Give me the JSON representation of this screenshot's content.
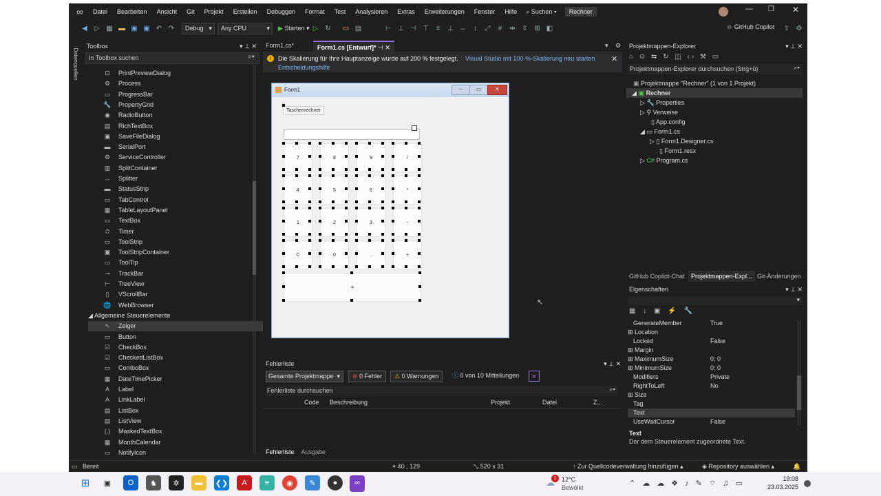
{
  "menu": [
    "Datei",
    "Bearbeiten",
    "Ansicht",
    "Git",
    "Projekt",
    "Erstellen",
    "Debuggen",
    "Format",
    "Test",
    "Analysieren",
    "Extras",
    "Erweiterungen",
    "Fenster",
    "Hilfe"
  ],
  "search_label": "Suchen",
  "solution_badge": "Rechner",
  "toolbar": {
    "config": "Debug",
    "platform": "Any CPU",
    "start": "Starten",
    "copilot": "GitHub Copilot"
  },
  "toolbox": {
    "title": "Toolbox",
    "search_placeholder": "In Toolbox suchen",
    "items": [
      "PrintPreviewDialog",
      "Process",
      "ProgressBar",
      "PropertyGrid",
      "RadioButton",
      "RichTextBox",
      "SaveFileDialog",
      "SerialPort",
      "ServiceController",
      "SplitContainer",
      "Splitter",
      "StatusStrip",
      "TabControl",
      "TableLayoutPanel",
      "TextBox",
      "Timer",
      "ToolStrip",
      "ToolStripContainer",
      "ToolTip",
      "TrackBar",
      "TreeView",
      "VScrollBar",
      "WebBrowser"
    ],
    "group": "Allgemeine Steuerelemente",
    "group_items": [
      "Zeiger",
      "Button",
      "CheckBox",
      "CheckedListBox",
      "ComboBox",
      "DateTimePicker",
      "Label",
      "LinkLabel",
      "ListBox",
      "ListView",
      "MaskedTextBox",
      "MonthCalendar",
      "NotifyIcon"
    ]
  },
  "left_rail": "Datenquellen",
  "tabs": [
    {
      "label": "Form1.cs*"
    },
    {
      "label": "Form1.cs [Entwurf]*"
    }
  ],
  "info_bar": {
    "message": "Die Skalierung für Ihre Hauptanzeige wurde auf 200 % festgelegt.",
    "link1": "Visual Studio mit 100-%-Skalierung neu starten",
    "link2": "Entscheidungshilfe"
  },
  "form": {
    "title": "Form1",
    "label": "Taschenrechner",
    "buttons": [
      "7",
      "8",
      "9",
      "/",
      "4",
      "5",
      "6",
      "*",
      "1",
      "2",
      "3",
      "-",
      "C",
      "0",
      ".",
      "+"
    ],
    "equals": "="
  },
  "error_list": {
    "title": "Fehlerliste",
    "scope": "Gesamte Projektmappe",
    "errors": "0 Fehler",
    "warnings": "0 Warnungen",
    "messages": "0 von 10 Mitteilungen",
    "search_placeholder": "Fehlerliste durchsuchen",
    "columns": [
      "Code",
      "Beschreibung",
      "Projekt",
      "Datei",
      "Z..."
    ],
    "bottom_tabs": [
      "Fehlerliste",
      "Ausgabe"
    ]
  },
  "solution_explorer": {
    "title": "Projektmappen-Explorer",
    "search_placeholder": "Projektmappen-Explorer durchsuchen (Strg+ü)",
    "solution": "Projektmappe \"Rechner\" (1 von 1 Projekt)",
    "project": "Rechner",
    "nodes": [
      "Properties",
      "Verweise",
      "App.config",
      "Form1.cs",
      "Form1.Designer.cs",
      "Form1.resx",
      "Program.cs"
    ],
    "bottom_tabs": [
      "GitHub Copilot-Chat",
      "Projektmappen-Expl...",
      "Git-Änderungen"
    ]
  },
  "properties": {
    "title": "Eigenschaften",
    "rows": [
      {
        "key": "GenerateMember",
        "value": "True"
      },
      {
        "key": "Location",
        "value": ""
      },
      {
        "key": "Locked",
        "value": "False"
      },
      {
        "key": "Margin",
        "value": ""
      },
      {
        "key": "MaximumSize",
        "value": "0; 0"
      },
      {
        "key": "MinimumSize",
        "value": "0; 0"
      },
      {
        "key": "Modifiers",
        "value": "Private"
      },
      {
        "key": "RightToLeft",
        "value": "No"
      },
      {
        "key": "Size",
        "value": ""
      },
      {
        "key": "Tag",
        "value": ""
      },
      {
        "key": "Text",
        "value": ""
      },
      {
        "key": "UseWaitCursor",
        "value": "False"
      }
    ],
    "desc_title": "Text",
    "desc_body": "Der dem Steuerelement zugeordnete Text."
  },
  "status": {
    "ready": "Bereit",
    "position": "40 , 129",
    "size": "520 x 31",
    "source_control": "Zur Quellcodeverwaltung hinzufügen",
    "repo": "Repository auswählen"
  },
  "taskbar": {
    "temp": "12°C",
    "weather": "Bewölkt",
    "time": "19:08",
    "date": "23.03.2025",
    "weather_badge": "1"
  }
}
